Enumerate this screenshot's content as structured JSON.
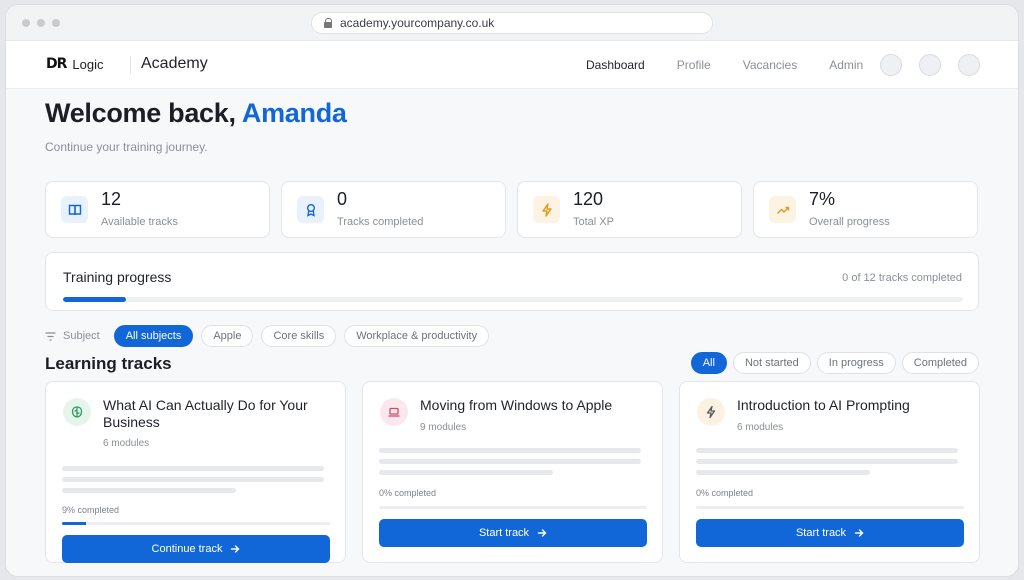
{
  "browser": {
    "url": "academy.yourcompany.co.uk"
  },
  "header": {
    "logo_mark": "DR",
    "logo_text": "Logic",
    "app_name": "Academy",
    "nav": [
      "Dashboard",
      "Profile",
      "Vacancies",
      "Admin"
    ],
    "active_nav": "Dashboard"
  },
  "welcome": {
    "prefix": "Welcome back, ",
    "name": "Amanda",
    "subtitle": "Continue your training journey."
  },
  "stats": [
    {
      "value": "12",
      "label": "Available tracks",
      "icon": "book-icon",
      "color": "#1267d8",
      "bg": "#e8f1fc"
    },
    {
      "value": "0",
      "label": "Tracks completed",
      "icon": "award-icon",
      "color": "#1267d8",
      "bg": "#e8f1fc"
    },
    {
      "value": "120",
      "label": "Total XP",
      "icon": "lightning-icon",
      "color": "#e39a1a",
      "bg": "#fdf3e2"
    },
    {
      "value": "7%",
      "label": "Overall progress",
      "icon": "trend-up-icon",
      "color": "#e39a1a",
      "bg": "#fdf3e2"
    }
  ],
  "progress": {
    "title": "Training progress",
    "count_text": "0 of 12 tracks completed",
    "fraction": 0.07
  },
  "filters": {
    "label": "Subject",
    "chips": [
      "All subjects",
      "Apple",
      "Core skills",
      "Workplace & productivity"
    ],
    "active": "All subjects"
  },
  "learning": {
    "title": "Learning tracks",
    "status_chips": [
      "All",
      "Not started",
      "In progress",
      "Completed"
    ],
    "active_status": "All"
  },
  "tracks": [
    {
      "title": "What AI Can Actually Do for Your Business",
      "modules": "6 modules",
      "completed_text": "9% completed",
      "progress": 0.09,
      "button": "Continue track",
      "icon": "brain-icon",
      "icon_color": "#2f9b62",
      "icon_bg": "#e6f5ec"
    },
    {
      "title": "Moving from Windows to Apple",
      "modules": "9 modules",
      "completed_text": "0% completed",
      "progress": 0,
      "button": "Start track",
      "icon": "laptop-icon",
      "icon_color": "#d04a6a",
      "icon_bg": "#fbe8ee"
    },
    {
      "title": "Introduction to AI Prompting",
      "modules": "6 modules",
      "completed_text": "0% completed",
      "progress": 0,
      "button": "Start track",
      "icon": "lightning-icon",
      "icon_color": "#555a63",
      "icon_bg": "#fdf1e2"
    }
  ]
}
